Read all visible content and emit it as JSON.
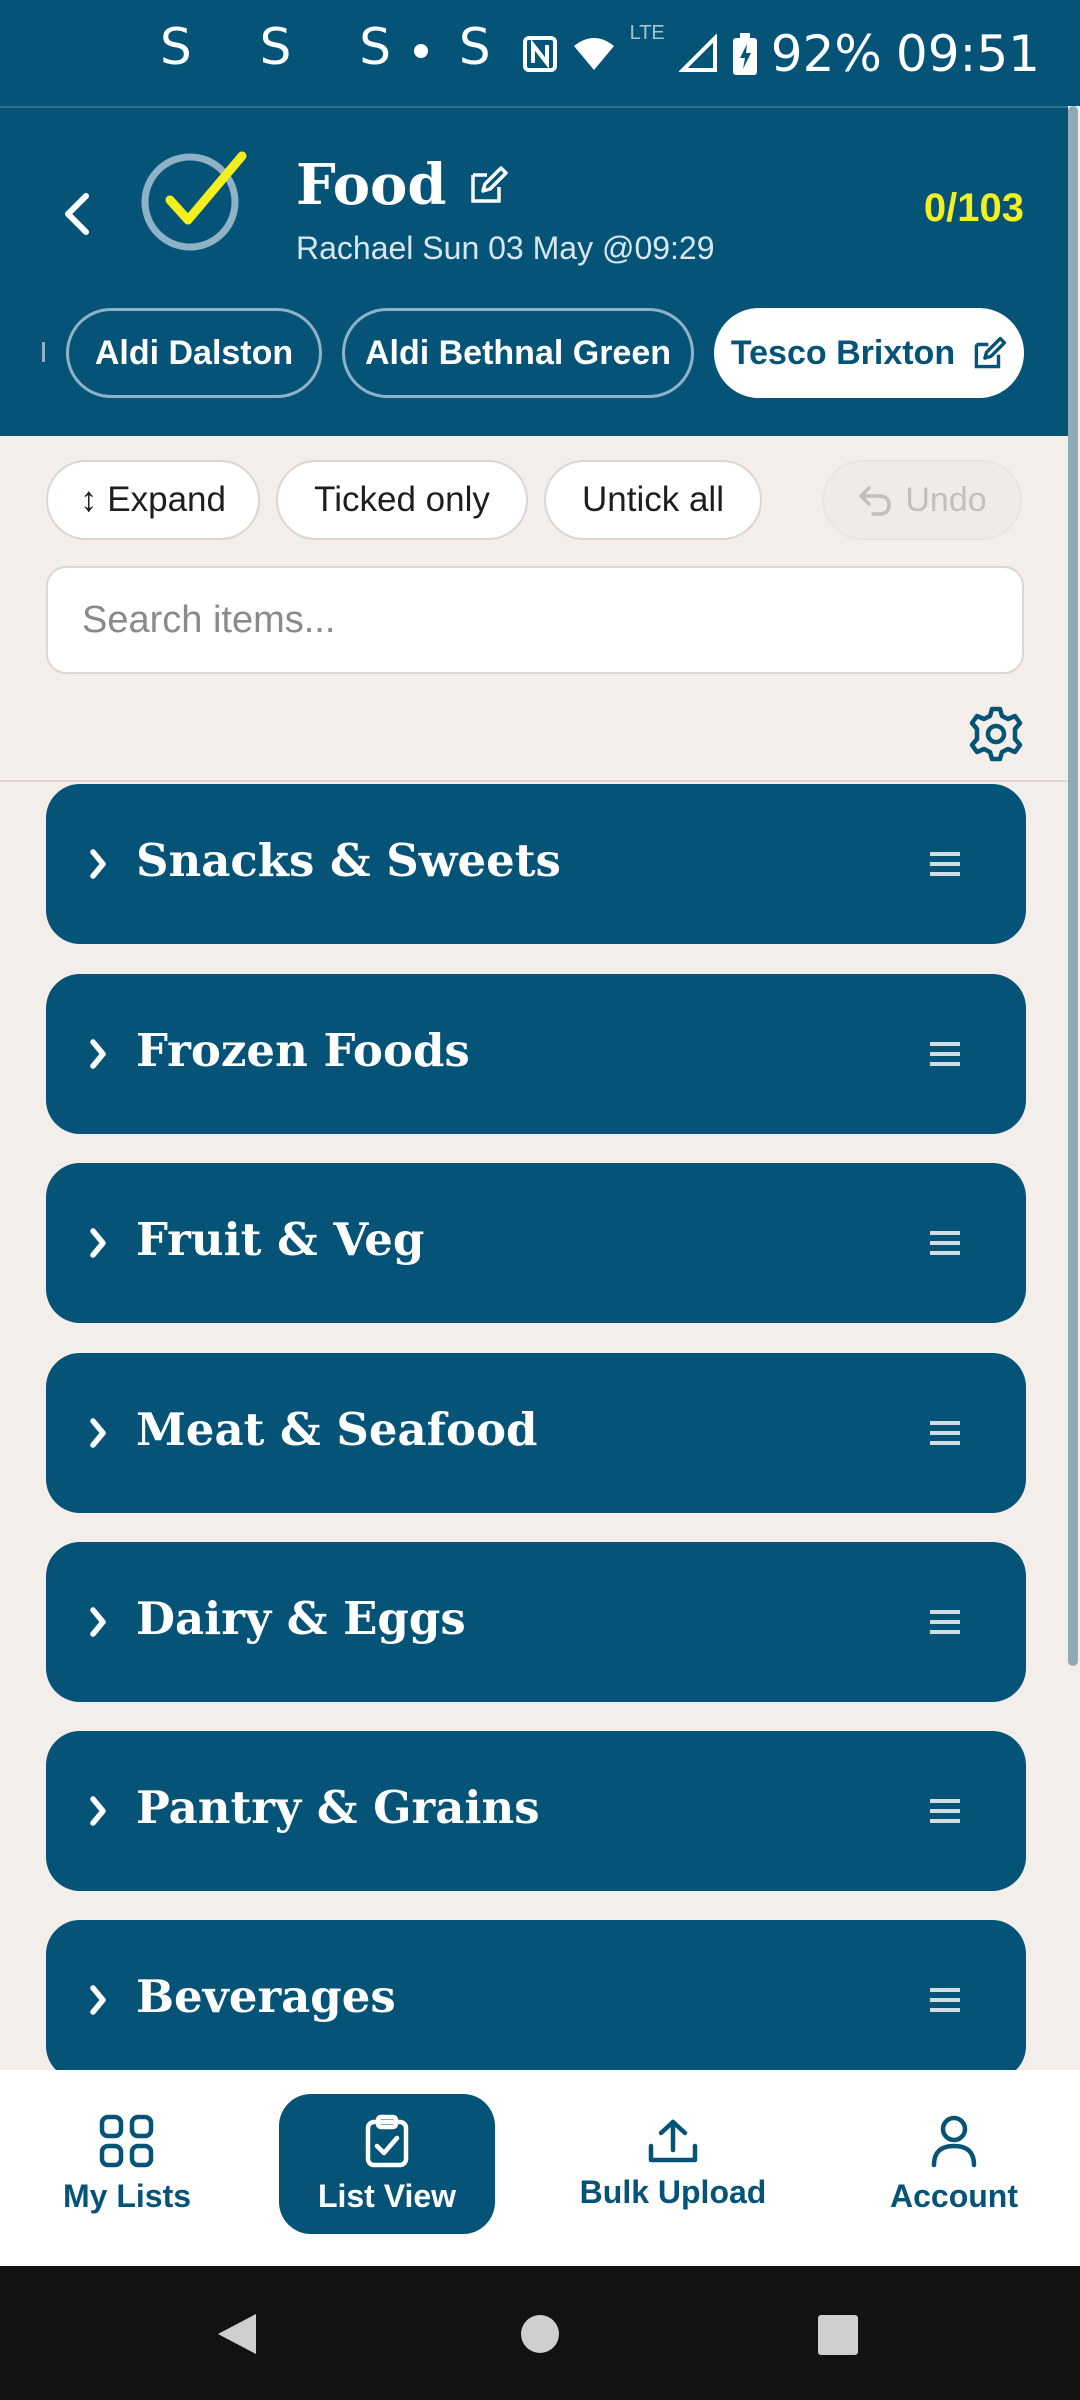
{
  "status_bar": {
    "left_glyphs": "S S S S",
    "battery": "92%",
    "time": "09:51",
    "network": "LTE",
    "icons": [
      "nfc-icon",
      "wifi-icon",
      "signal-icon",
      "battery-charging-icon"
    ]
  },
  "header": {
    "title": "Food",
    "subtitle": "Rachael Sun 03 May @09:29",
    "counter": "0/103",
    "stores": [
      {
        "label": "Aldi Dalston",
        "active": false
      },
      {
        "label": "Aldi Bethnal Green",
        "active": false
      },
      {
        "label": "Tesco Brixton",
        "active": true
      }
    ]
  },
  "filters": {
    "expand": "↕ Expand",
    "ticked_only": "Ticked only",
    "untick_all": "Untick all",
    "undo": "Undo"
  },
  "search": {
    "placeholder": "Search items...",
    "value": ""
  },
  "categories": [
    "Snacks & Sweets",
    "Frozen Foods",
    "Fruit & Veg",
    "Meat & Seafood",
    "Dairy & Eggs",
    "Pantry & Grains",
    "Beverages"
  ],
  "bottom_nav": [
    {
      "label": "My Lists",
      "icon": "grid-icon",
      "active": false
    },
    {
      "label": "List View",
      "icon": "clipboard-check-icon",
      "active": true
    },
    {
      "label": "Bulk Upload",
      "icon": "upload-icon",
      "active": false
    },
    {
      "label": "Account",
      "icon": "person-icon",
      "active": false
    }
  ],
  "colors": {
    "primary": "#055478",
    "accent_yellow": "#f4ef1e",
    "background": "#f3eeea"
  }
}
